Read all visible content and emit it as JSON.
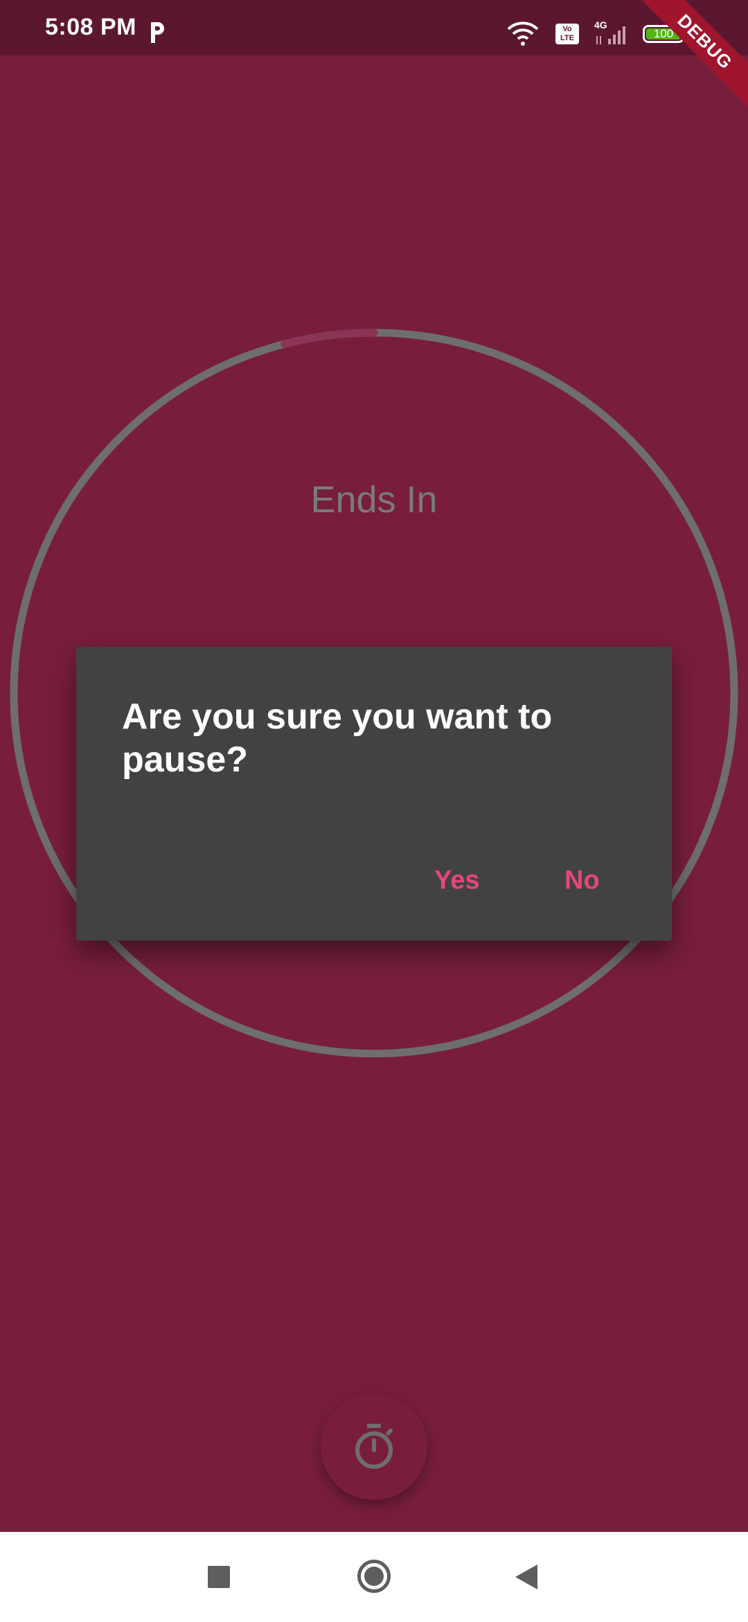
{
  "status_bar": {
    "time": "5:08 PM",
    "network_type": "4G",
    "volte_label": "Vo LTE",
    "battery_level": "100",
    "debug_banner": "DEBUG",
    "icons": [
      "parking-icon",
      "wifi-icon",
      "volte-icon",
      "signal-icon",
      "battery-icon"
    ]
  },
  "timer": {
    "label": "Ends In",
    "progress_fraction": 0.04,
    "ring_color": "#6e6e6e"
  },
  "dialog": {
    "title": "Are you sure you want to pause?",
    "yes_label": "Yes",
    "no_label": "No",
    "action_color": "#e64779"
  },
  "fab": {
    "icon": "stopwatch-icon"
  },
  "nav_bar": {
    "icons": [
      "recents-icon",
      "home-icon",
      "back-icon"
    ]
  },
  "colors": {
    "background": "#781e3c",
    "status_bar": "#5b1630",
    "dialog": "#424242",
    "debug_ribbon": "#a0152e"
  }
}
